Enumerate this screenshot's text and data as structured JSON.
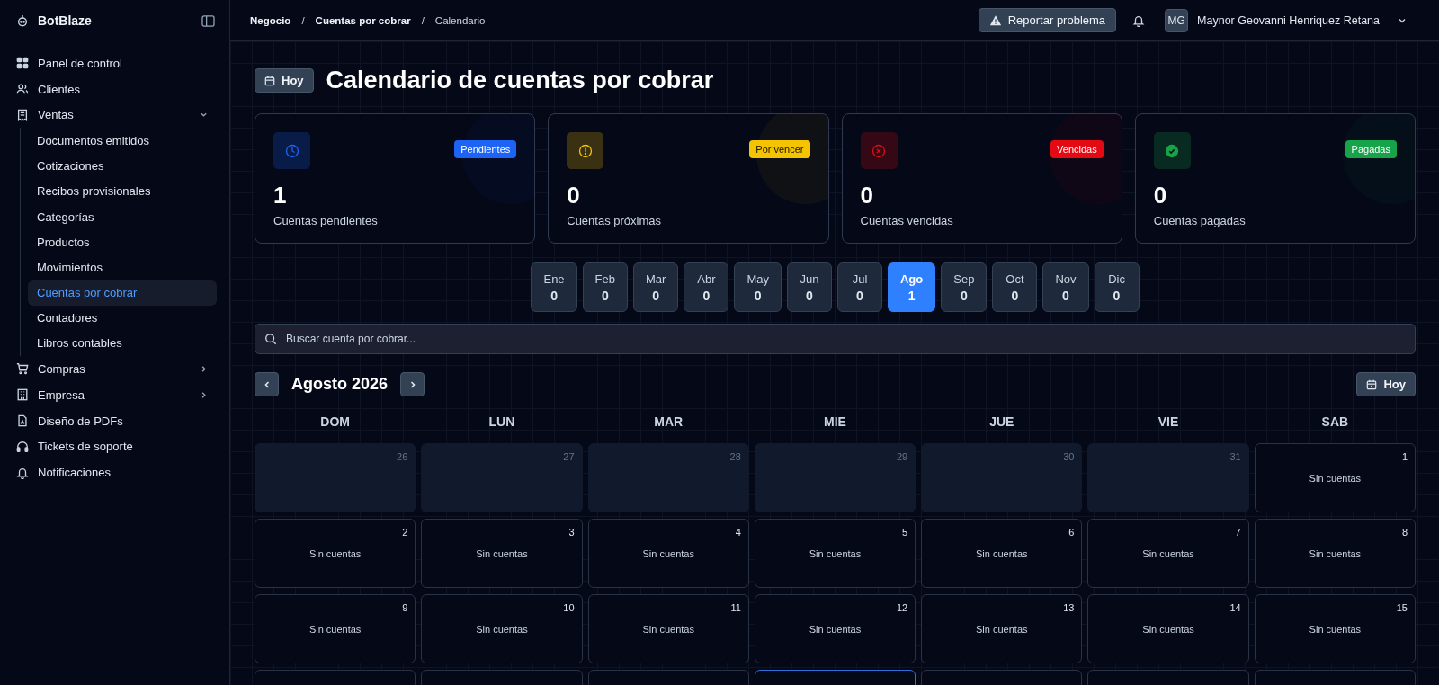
{
  "brand": {
    "name": "BotBlaze"
  },
  "sidebar": {
    "items": [
      {
        "label": "Panel de control",
        "kind": "link",
        "selected": false
      },
      {
        "label": "Clientes",
        "kind": "link",
        "selected": false
      },
      {
        "label": "Ventas",
        "kind": "group",
        "selected": false,
        "expanded": true,
        "children": [
          {
            "label": "Documentos emitidos",
            "selected": false
          },
          {
            "label": "Cotizaciones",
            "selected": false
          },
          {
            "label": "Recibos provisionales",
            "selected": false
          },
          {
            "label": "Categorías",
            "selected": false
          },
          {
            "label": "Productos",
            "selected": false
          },
          {
            "label": "Movimientos",
            "selected": false
          },
          {
            "label": "Cuentas por cobrar",
            "selected": true
          },
          {
            "label": "Contadores",
            "selected": false
          },
          {
            "label": "Libros contables",
            "selected": false
          }
        ]
      },
      {
        "label": "Compras",
        "kind": "group",
        "selected": false,
        "expanded": false
      },
      {
        "label": "Empresa",
        "kind": "group",
        "selected": false,
        "expanded": false
      },
      {
        "label": "Diseño de PDFs",
        "kind": "link",
        "selected": false
      },
      {
        "label": "Tickets de soporte",
        "kind": "link",
        "selected": false
      },
      {
        "label": "Notificaciones",
        "kind": "link",
        "selected": false
      }
    ]
  },
  "breadcrumb": {
    "separator": "/",
    "items": [
      "Negocio",
      "Cuentas por cobrar",
      "Calendario"
    ]
  },
  "header": {
    "report_button": "Reportar problema",
    "user": {
      "initials": "MG",
      "name": "Maynor Geovanni Henriquez Retana"
    }
  },
  "page": {
    "today_button": "Hoy",
    "title": "Calendario de cuentas por cobrar"
  },
  "stats": [
    {
      "value": "1",
      "label": "Cuentas pendientes",
      "badge": "Pendientes",
      "color": "#1d63f5"
    },
    {
      "value": "0",
      "label": "Cuentas próximas",
      "badge": "Por vencer",
      "color": "#f5c400"
    },
    {
      "value": "0",
      "label": "Cuentas vencidas",
      "badge": "Vencidas",
      "color": "#e50914"
    },
    {
      "value": "0",
      "label": "Cuentas pagadas",
      "badge": "Pagadas",
      "color": "#16a34a"
    }
  ],
  "months": [
    {
      "name": "Ene",
      "count": "0",
      "selected": false
    },
    {
      "name": "Feb",
      "count": "0",
      "selected": false
    },
    {
      "name": "Mar",
      "count": "0",
      "selected": false
    },
    {
      "name": "Abr",
      "count": "0",
      "selected": false
    },
    {
      "name": "May",
      "count": "0",
      "selected": false
    },
    {
      "name": "Jun",
      "count": "0",
      "selected": false
    },
    {
      "name": "Jul",
      "count": "0",
      "selected": false
    },
    {
      "name": "Ago",
      "count": "1",
      "selected": true
    },
    {
      "name": "Sep",
      "count": "0",
      "selected": false
    },
    {
      "name": "Oct",
      "count": "0",
      "selected": false
    },
    {
      "name": "Nov",
      "count": "0",
      "selected": false
    },
    {
      "name": "Dic",
      "count": "0",
      "selected": false
    }
  ],
  "search": {
    "placeholder": "Buscar cuenta por cobrar..."
  },
  "calendar": {
    "title": "Agosto 2026",
    "today_button": "Hoy",
    "weekdays": [
      "DOM",
      "LUN",
      "MAR",
      "MIE",
      "JUE",
      "VIE",
      "SAB"
    ],
    "weeks": [
      [
        {
          "day": "26",
          "kind": "outside",
          "today": false
        },
        {
          "day": "27",
          "kind": "outside",
          "today": false
        },
        {
          "day": "28",
          "kind": "outside",
          "today": false
        },
        {
          "day": "29",
          "kind": "outside",
          "today": false
        },
        {
          "day": "30",
          "kind": "outside",
          "today": false
        },
        {
          "day": "31",
          "kind": "outside",
          "today": false
        },
        {
          "day": "1",
          "kind": "current",
          "note": "Sin cuentas",
          "today": false
        }
      ],
      [
        {
          "day": "2",
          "kind": "current",
          "note": "Sin cuentas",
          "today": false
        },
        {
          "day": "3",
          "kind": "current",
          "note": "Sin cuentas",
          "today": false
        },
        {
          "day": "4",
          "kind": "current",
          "note": "Sin cuentas",
          "today": false
        },
        {
          "day": "5",
          "kind": "current",
          "note": "Sin cuentas",
          "today": false
        },
        {
          "day": "6",
          "kind": "current",
          "note": "Sin cuentas",
          "today": false
        },
        {
          "day": "7",
          "kind": "current",
          "note": "Sin cuentas",
          "today": false
        },
        {
          "day": "8",
          "kind": "current",
          "note": "Sin cuentas",
          "today": false
        }
      ],
      [
        {
          "day": "9",
          "kind": "current",
          "note": "Sin cuentas",
          "today": false
        },
        {
          "day": "10",
          "kind": "current",
          "note": "Sin cuentas",
          "today": false
        },
        {
          "day": "11",
          "kind": "current",
          "note": "Sin cuentas",
          "today": false
        },
        {
          "day": "12",
          "kind": "current",
          "note": "Sin cuentas",
          "today": false
        },
        {
          "day": "13",
          "kind": "current",
          "note": "Sin cuentas",
          "today": false
        },
        {
          "day": "14",
          "kind": "current",
          "note": "Sin cuentas",
          "today": false
        },
        {
          "day": "15",
          "kind": "current",
          "note": "Sin cuentas",
          "today": false
        }
      ],
      [
        {
          "kind": "current",
          "today": false
        },
        {
          "kind": "current",
          "today": false
        },
        {
          "kind": "current",
          "today": false
        },
        {
          "kind": "current",
          "today": true
        },
        {
          "kind": "current",
          "today": false
        },
        {
          "kind": "current",
          "today": false
        },
        {
          "kind": "current",
          "today": false
        }
      ]
    ]
  }
}
